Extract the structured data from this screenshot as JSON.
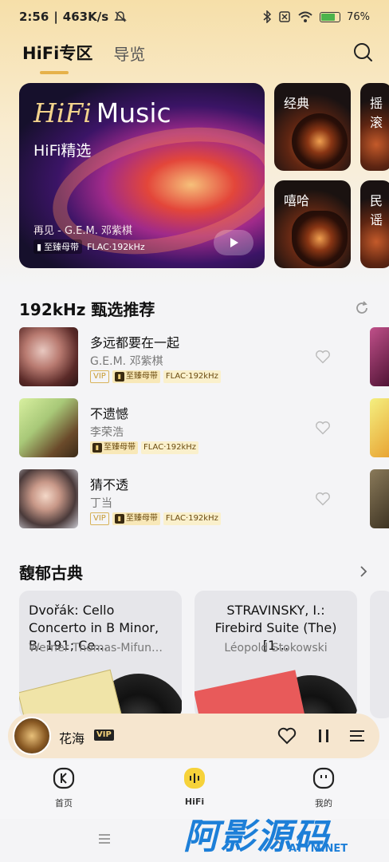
{
  "status_bar": {
    "time": "2:56",
    "speed": "463K/s",
    "battery": "76%"
  },
  "header": {
    "tabs": [
      "HiFi专区",
      "导览"
    ],
    "active_tab": 0
  },
  "hero": {
    "title_italic": "HiFi",
    "title_rest": "Music",
    "subtitle": "HiFi精选",
    "song": "再见 - G.E.M. 邓紫棋",
    "tag_quality": "至臻母带",
    "tag_format": "FLAC·192kHz"
  },
  "genres": [
    "经典",
    "嘻哈",
    "摇滚",
    "民谣"
  ],
  "recommend": {
    "title": "192kHz 甄选推荐",
    "tracks": [
      {
        "title": "多远都要在一起",
        "artist": "G.E.M. 邓紫棋",
        "vip": "VIP",
        "quality": "至臻母带",
        "format": "FLAC·192kHz"
      },
      {
        "title": "不遗憾",
        "artist": "李荣浩",
        "vip": "",
        "quality": "至臻母带",
        "format": "FLAC·192kHz"
      },
      {
        "title": "猜不透",
        "artist": "丁当",
        "vip": "VIP",
        "quality": "至臻母带",
        "format": "FLAC·192kHz"
      }
    ]
  },
  "classic": {
    "title": "馥郁古典",
    "cards": [
      {
        "title": "Dvořák: Cello Concerto in B Minor, B. 191; Ce…",
        "artist": "Werner Thomas-Mifun…"
      },
      {
        "title": "STRAVINSKY, I.: Firebird Suite (The) [1…",
        "artist": "Léopold Stokowski"
      }
    ]
  },
  "player": {
    "title": "花海",
    "vip": "VIP"
  },
  "nav": {
    "items": [
      "首页",
      "HiFi",
      "我的"
    ],
    "active": 1
  },
  "watermark": {
    "big": "阿影源码",
    "small": "AYYM.NET"
  },
  "colors": {
    "accent": "#e6b14a",
    "nav_active": "#f6d23a",
    "vip_gold": "#c69a33"
  }
}
